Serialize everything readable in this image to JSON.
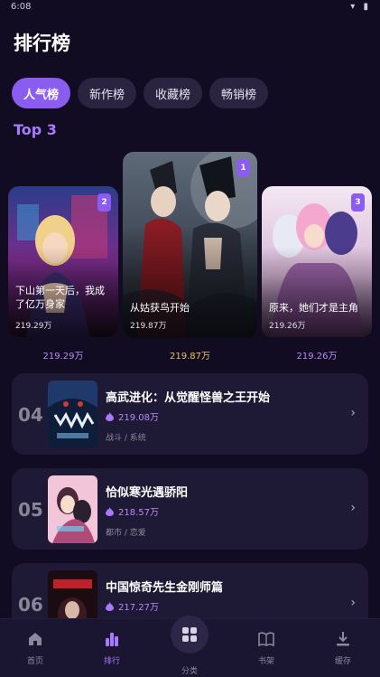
{
  "status": {
    "time": "6:08",
    "icons": "▾ ▮"
  },
  "page": {
    "title": "排行榜"
  },
  "tabs": [
    {
      "label": "人气榜",
      "active": true
    },
    {
      "label": "新作榜",
      "active": false
    },
    {
      "label": "收藏榜",
      "active": false
    },
    {
      "label": "畅销榜",
      "active": false
    }
  ],
  "top3": {
    "heading": "Top 3",
    "cards": [
      {
        "rank": "2",
        "title": "下山第一天后，我成了亿万身家",
        "heat": "219.29万",
        "below": "219.29万"
      },
      {
        "rank": "1",
        "title": "从姑获鸟开始",
        "heat": "219.87万",
        "below": "219.87万"
      },
      {
        "rank": "3",
        "title": "原来，她们才是主角",
        "heat": "219.26万",
        "below": "219.26万"
      }
    ]
  },
  "list": [
    {
      "rank": "04",
      "title": "高武进化：从觉醒怪兽之王开始",
      "heat": "219.08万",
      "tags": "战斗 / 系统"
    },
    {
      "rank": "05",
      "title": "恰似寒光遇骄阳",
      "heat": "218.57万",
      "tags": "都市 / 恋爱"
    },
    {
      "rank": "06",
      "title": "中国惊奇先生金刚师篇",
      "heat": "217.27万",
      "tags": ""
    }
  ],
  "nav": {
    "home": "首页",
    "rank": "排行",
    "category": "分类",
    "shelf": "书架",
    "cache": "缓存"
  },
  "colors": {
    "accent": "#8a5cf0",
    "background": "#120c22",
    "card": "#1e1934",
    "gold": "#e8c05a"
  }
}
